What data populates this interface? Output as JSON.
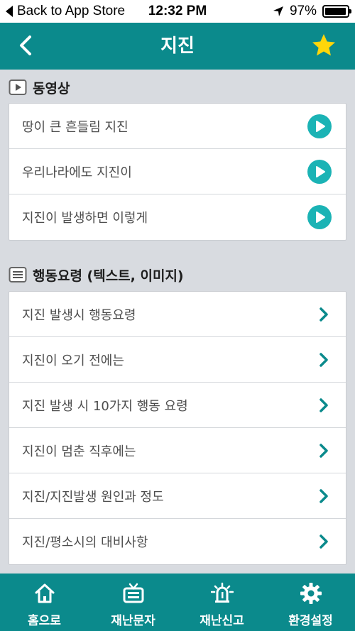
{
  "status_bar": {
    "back_label": "Back to App Store",
    "time": "12:32 PM",
    "battery_text": "97%",
    "battery_level": 0.97
  },
  "header": {
    "title": "지진",
    "back_icon": "chevron-left-icon",
    "favorite_icon": "star-icon",
    "favorite_color": "#ffd60a"
  },
  "videos": {
    "title": "동영상",
    "items": [
      {
        "label": "땅이 큰 흔들림 지진"
      },
      {
        "label": "우리나라에도 지진이"
      },
      {
        "label": "지진이 발생하면 이렇게"
      }
    ]
  },
  "guides": {
    "title": "행동요령 (텍스트, 이미지)",
    "items": [
      {
        "label": "지진 발생시 행동요령"
      },
      {
        "label": "지진이 오기 전에는"
      },
      {
        "label": "지진 발생 시 10가지 행동 요령"
      },
      {
        "label": "지진이 멈춘 직후에는"
      },
      {
        "label": "지진/지진발생 원인과 정도"
      },
      {
        "label": "지진/평소시의 대비사항"
      }
    ]
  },
  "tabbar": {
    "tabs": [
      {
        "label": "홈으로",
        "icon": "home-icon"
      },
      {
        "label": "재난문자",
        "icon": "tv-icon"
      },
      {
        "label": "재난신고",
        "icon": "siren-icon"
      },
      {
        "label": "환경설정",
        "icon": "gear-icon"
      }
    ]
  },
  "colors": {
    "primary": "#0b8a8c",
    "accent": "#1bb3b5",
    "background": "#d8dbe0"
  }
}
